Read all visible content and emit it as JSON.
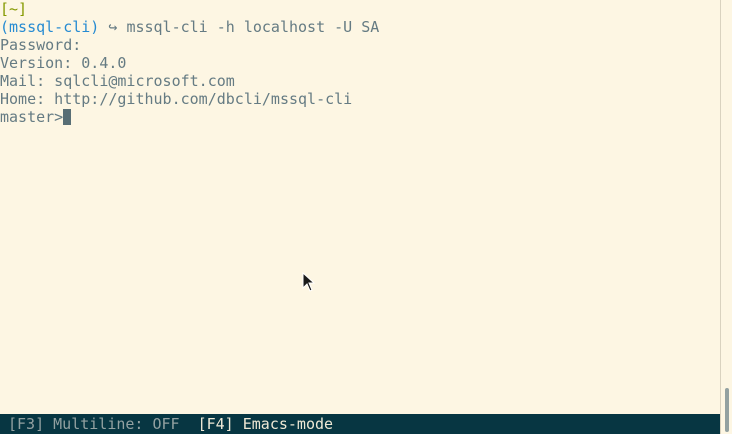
{
  "terminal": {
    "cwd_prompt": "[~]",
    "env_name": "(mssql-cli)",
    "arrow": "↪",
    "command": "mssql-cli -h localhost -U SA",
    "password_line": "Password:",
    "version_line": "Version: 0.4.0",
    "mail_line": "Mail: sqlcli@microsoft.com",
    "home_line": "Home: http://github.com/dbcli/mssql-cli",
    "db_prompt": "master>"
  },
  "statusbar": {
    "multiline": "[F3] Multiline: OFF",
    "mode": "[F4] Emacs-mode"
  },
  "colors": {
    "background": "#fdf6e3",
    "text": "#657b83",
    "green": "#859900",
    "blue": "#268bd2",
    "statusbar": "#073642"
  },
  "icons": {
    "pointer": "mouse-pointer-icon"
  }
}
